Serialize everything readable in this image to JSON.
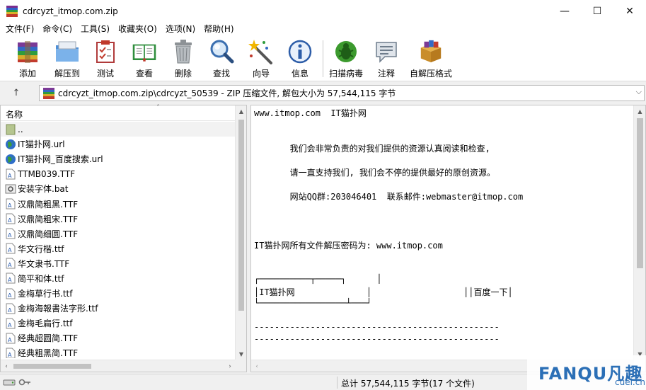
{
  "window": {
    "title": "cdrcyzt_itmop.com.zip",
    "minimize": "—",
    "maximize": "☐",
    "close": "✕"
  },
  "menu": [
    "文件(F)",
    "命令(C)",
    "工具(S)",
    "收藏夹(O)",
    "选项(N)",
    "帮助(H)"
  ],
  "toolbar": {
    "add": "添加",
    "extract": "解压到",
    "test": "测试",
    "view": "查看",
    "delete": "删除",
    "find": "查找",
    "wizard": "向导",
    "info": "信息",
    "virus_scan": "扫描病毒",
    "comment": "注释",
    "sfx": "自解压格式"
  },
  "address": {
    "up_arrow": "↑",
    "path": "cdrcyzt_itmop.com.zip\\cdrcyzt_50539 - ZIP 压缩文件, 解包大小为 57,544,115 字节",
    "dropdown": "⌵"
  },
  "file_list": {
    "column_name": "名称",
    "sort_indicator": "˄",
    "items": [
      {
        "name": "..",
        "icon": "folder-up-icon"
      },
      {
        "name": "IT猫扑网.url",
        "icon": "globe-icon"
      },
      {
        "name": "IT猫扑网_百度搜索.url",
        "icon": "globe-icon"
      },
      {
        "name": "TTMB039.TTF",
        "icon": "font-file-icon"
      },
      {
        "name": "安装字体.bat",
        "icon": "gear-file-icon"
      },
      {
        "name": "汉鼎简粗黑.TTF",
        "icon": "font-file-icon"
      },
      {
        "name": "汉鼎简粗宋.TTF",
        "icon": "font-file-icon"
      },
      {
        "name": "汉鼎简细圆.TTF",
        "icon": "font-file-icon"
      },
      {
        "name": "华文行楷.ttf",
        "icon": "font-file-icon"
      },
      {
        "name": "华文隶书.TTF",
        "icon": "font-file-icon"
      },
      {
        "name": "简平和体.ttf",
        "icon": "font-file-icon"
      },
      {
        "name": "金梅草行书.ttf",
        "icon": "font-file-icon"
      },
      {
        "name": "金梅海報書法字形.ttf",
        "icon": "font-file-icon"
      },
      {
        "name": "金梅毛扁行.ttf",
        "icon": "font-file-icon"
      },
      {
        "name": "经典超圆简.TTF",
        "icon": "font-file-icon"
      },
      {
        "name": "经典粗黑简.TTF",
        "icon": "font-file-icon"
      }
    ]
  },
  "scroll": {
    "up": "▲",
    "down": "▼",
    "left": "‹",
    "right": "›"
  },
  "comment": {
    "lines": [
      "www.itmop.com  IT猫扑网",
      "",
      "       我们会非常负责的对我们提供的资源认真阅读和检查,",
      "",
      "       请一直支持我们, 我们会不停的提供最好的原创资源。",
      "",
      "       网站QQ群:203046401  联系邮件:webmaster@itmop.com",
      "",
      "IT猫扑网所有文件解压密码为: www.itmop.com",
      "┌──────────┬─────┐      │",
      "│IT猫扑网              │                  ││百度一下│",
      "└─────────────────┴───┘",
      "------------------------------------------------",
      "------------------------------------------------"
    ]
  },
  "status": {
    "total": "总计 57,544,115 字节(17 个文件)"
  },
  "watermark": {
    "main": "FANQU",
    "cn": "凡趣",
    "sub": "cuel.cn"
  },
  "colors": {
    "accent": "#2b6fb6",
    "border": "#c6c6c6",
    "toolbar_bg": "#ffffff",
    "chrome_bg": "#f0f0f0"
  }
}
